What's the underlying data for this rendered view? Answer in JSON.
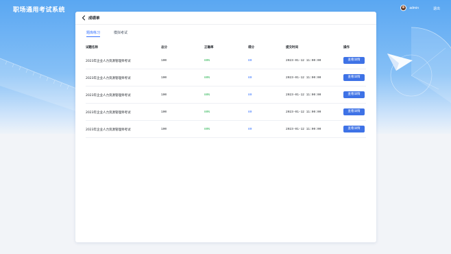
{
  "header": {
    "app_title": "职场通用考试系统",
    "username": "admin",
    "logout_label": "退出"
  },
  "page": {
    "title": "成绩单"
  },
  "tabs": [
    {
      "label": "题库练习",
      "active": true
    },
    {
      "label": "模拟考试",
      "active": false
    }
  ],
  "table": {
    "columns": [
      "试题名称",
      "总分",
      "正确率",
      "得分",
      "提交时间",
      "操作"
    ],
    "rows": [
      {
        "name": "2023年企业人力资源管理师考试",
        "total": "100",
        "rate": "80%",
        "score": "80",
        "time": "2023-01-12 11:00:00",
        "action": "查看详情"
      },
      {
        "name": "2023年企业人力资源管理师考试",
        "total": "100",
        "rate": "80%",
        "score": "80",
        "time": "2023-01-12 11:00:00",
        "action": "查看详情"
      },
      {
        "name": "2023年企业人力资源管理师考试",
        "total": "100",
        "rate": "80%",
        "score": "80",
        "time": "2023-01-12 11:00:00",
        "action": "查看详情"
      },
      {
        "name": "2023年企业人力资源管理师考试",
        "total": "100",
        "rate": "80%",
        "score": "80",
        "time": "2023-01-12 11:00:00",
        "action": "查看详情"
      },
      {
        "name": "2023年企业人力资源管理师考试",
        "total": "100",
        "rate": "80%",
        "score": "80",
        "time": "2023-01-12 11:00:00",
        "action": "查看详情"
      }
    ]
  },
  "colors": {
    "accent": "#3370ff",
    "button": "#3e72e6",
    "success": "#22b14c"
  },
  "icons": [
    "back-arrow-icon",
    "paper-plane-icon",
    "protractor-icon",
    "ruler-icon"
  ]
}
